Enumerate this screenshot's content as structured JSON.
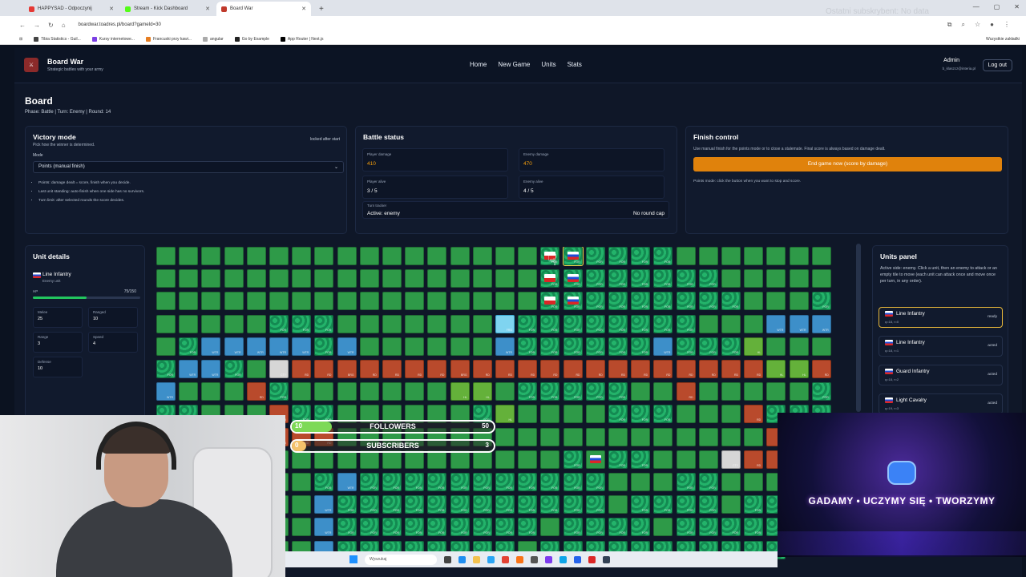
{
  "browser": {
    "tabs": [
      {
        "label": "HAPPYSAD - Odpoczynij",
        "color": "#e53935",
        "active": false
      },
      {
        "label": "Stream - Kick Dashboard",
        "color": "#53fc18",
        "active": false
      },
      {
        "label": "Board War",
        "color": "#c0392b",
        "active": true
      }
    ],
    "new_tab": "+",
    "address": "boardwar.toadres.pl/board?gameId=30",
    "overlay_text": "Ostatni subskrybent: No data",
    "bookmarks": [
      "Tibia Statistics - Guil...",
      "Kursy internetowe...",
      "Francuski przy kawi...",
      "angular",
      "Go by Example",
      "App Router | Next.js"
    ],
    "all_bookmarks": "Wszystkie zakładki"
  },
  "app": {
    "brand": "Board War",
    "brand_sub": "Strategic battles with your army",
    "nav": [
      "Home",
      "New Game",
      "Units",
      "Stats"
    ],
    "admin": "Admin",
    "admin_email": "b_klaszcz@interia.pl",
    "logout": "Log out"
  },
  "page": {
    "title": "Board",
    "subtitle": "Phase: Battle | Turn: Enemy | Round: 14"
  },
  "victory": {
    "title": "Victory mode",
    "help": "Pick how the winner is determined.",
    "locked": "locked after start",
    "mode_label": "Mode",
    "selected": "Points (manual finish)",
    "rules": [
      "Points: damage dealt = score, finish when you decide.",
      "Last unit standing: auto-finish when one side has no survivors.",
      "Turn limit: after selected rounds the score decides."
    ]
  },
  "battle": {
    "title": "Battle status",
    "player_damage_label": "Player damage",
    "player_damage": "410",
    "enemy_damage_label": "Enemy damage",
    "enemy_damage": "470",
    "player_alive_label": "Player alive",
    "player_alive": "3 / 5",
    "enemy_alive_label": "Enemy alive",
    "enemy_alive": "4 / 5",
    "turn_label": "Turn tracker",
    "turn_value": "Active: enemy",
    "cap": "No round cap"
  },
  "finish": {
    "title": "Finish control",
    "help": "Use manual finish for the points mode or to close a stalemate. Final score is always based on damage dealt.",
    "button": "End game now (score by damage)",
    "note": "Points mode: click the button when you want to stop and score."
  },
  "unit_details": {
    "title": "Unit details",
    "name": "Line Infantry",
    "side": "Enemy unit",
    "hp_label": "HP",
    "hp_text": "75/150",
    "hp_fraction": 0.5,
    "stats": [
      {
        "label": "Melee",
        "value": "25"
      },
      {
        "label": "Ranged",
        "value": "10"
      },
      {
        "label": "Range",
        "value": "3"
      },
      {
        "label": "Speed",
        "value": "4"
      },
      {
        "label": "Defense",
        "value": "10"
      }
    ]
  },
  "units_panel": {
    "title": "Units panel",
    "help": "Active side: enemy. Click a unit, then an enemy to attack or an empty tile to move (each unit can attack once and move once per turn, in any order).",
    "units": [
      {
        "name": "Line Infantry",
        "sub": "q=18, r=0",
        "status": "ready"
      },
      {
        "name": "Line Infantry",
        "sub": "q=18, r=1",
        "status": "acted"
      },
      {
        "name": "Guard Infantry",
        "sub": "q=18, r=2",
        "status": "acted"
      },
      {
        "name": "Light Cavalry",
        "sub": "q=19, r=3",
        "status": "acted"
      }
    ]
  },
  "board_legend": {
    "forest": "FOR",
    "water": "WTR",
    "swamp": "SWP",
    "road": "RD",
    "bridge": "BRG",
    "hill": "HL",
    "city": "CTY",
    "ford": "FRD"
  },
  "stream_overlay": {
    "followers_label": "FOLLOWERS",
    "followers_current": "10",
    "followers_goal": "50",
    "followers_fraction": 0.2,
    "subscribers_label": "SUBSCRIBERS",
    "subscribers_current": "0",
    "subscribers_goal": "3",
    "subscribers_fraction": 0.0,
    "promo_title": "GADAMY • UCZYMY SIĘ • TWORZYMY"
  },
  "taskbar": {
    "search": "Wyszukaj"
  },
  "colors": {
    "accent_orange": "#e0820c",
    "grass": "#2e9a48",
    "road": "#b94a2c",
    "water": "#3d8fc9",
    "ready_border": "#e7b73a"
  }
}
